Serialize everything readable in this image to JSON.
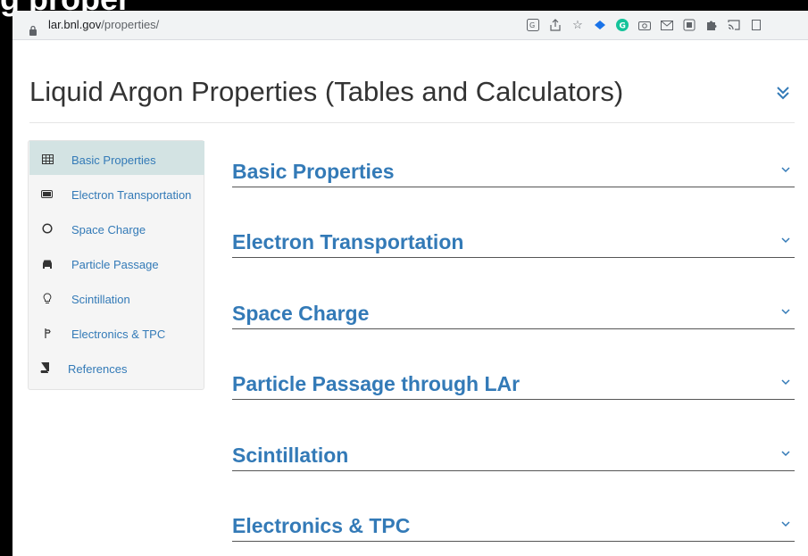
{
  "browser": {
    "url_host": "lar.bnl.gov",
    "url_path": "/properties/"
  },
  "top_frame_text": "g proper",
  "page": {
    "title": "Liquid Argon Properties (Tables and Calculators)"
  },
  "sidebar": {
    "items": [
      {
        "label": "Basic Properties",
        "icon": "table-icon",
        "active": true
      },
      {
        "label": "Electron Transportation",
        "icon": "battery-icon",
        "active": false
      },
      {
        "label": "Space Charge",
        "icon": "circle-icon",
        "active": false
      },
      {
        "label": "Particle Passage",
        "icon": "car-icon",
        "active": false
      },
      {
        "label": "Scintillation",
        "icon": "lightbulb-icon",
        "active": false
      },
      {
        "label": "Electronics & TPC",
        "icon": "microchip-icon",
        "active": false
      },
      {
        "label": "References",
        "icon": "book-icon",
        "active": false
      }
    ]
  },
  "sections": [
    {
      "title": "Basic Properties"
    },
    {
      "title": "Electron Transportation"
    },
    {
      "title": "Space Charge"
    },
    {
      "title": "Particle Passage through LAr"
    },
    {
      "title": "Scintillation"
    },
    {
      "title": "Electronics & TPC"
    }
  ],
  "colors": {
    "accent": "#337ab7",
    "sidebar_bg": "#f5f5f5",
    "active_bg": "#d3e3e3"
  }
}
